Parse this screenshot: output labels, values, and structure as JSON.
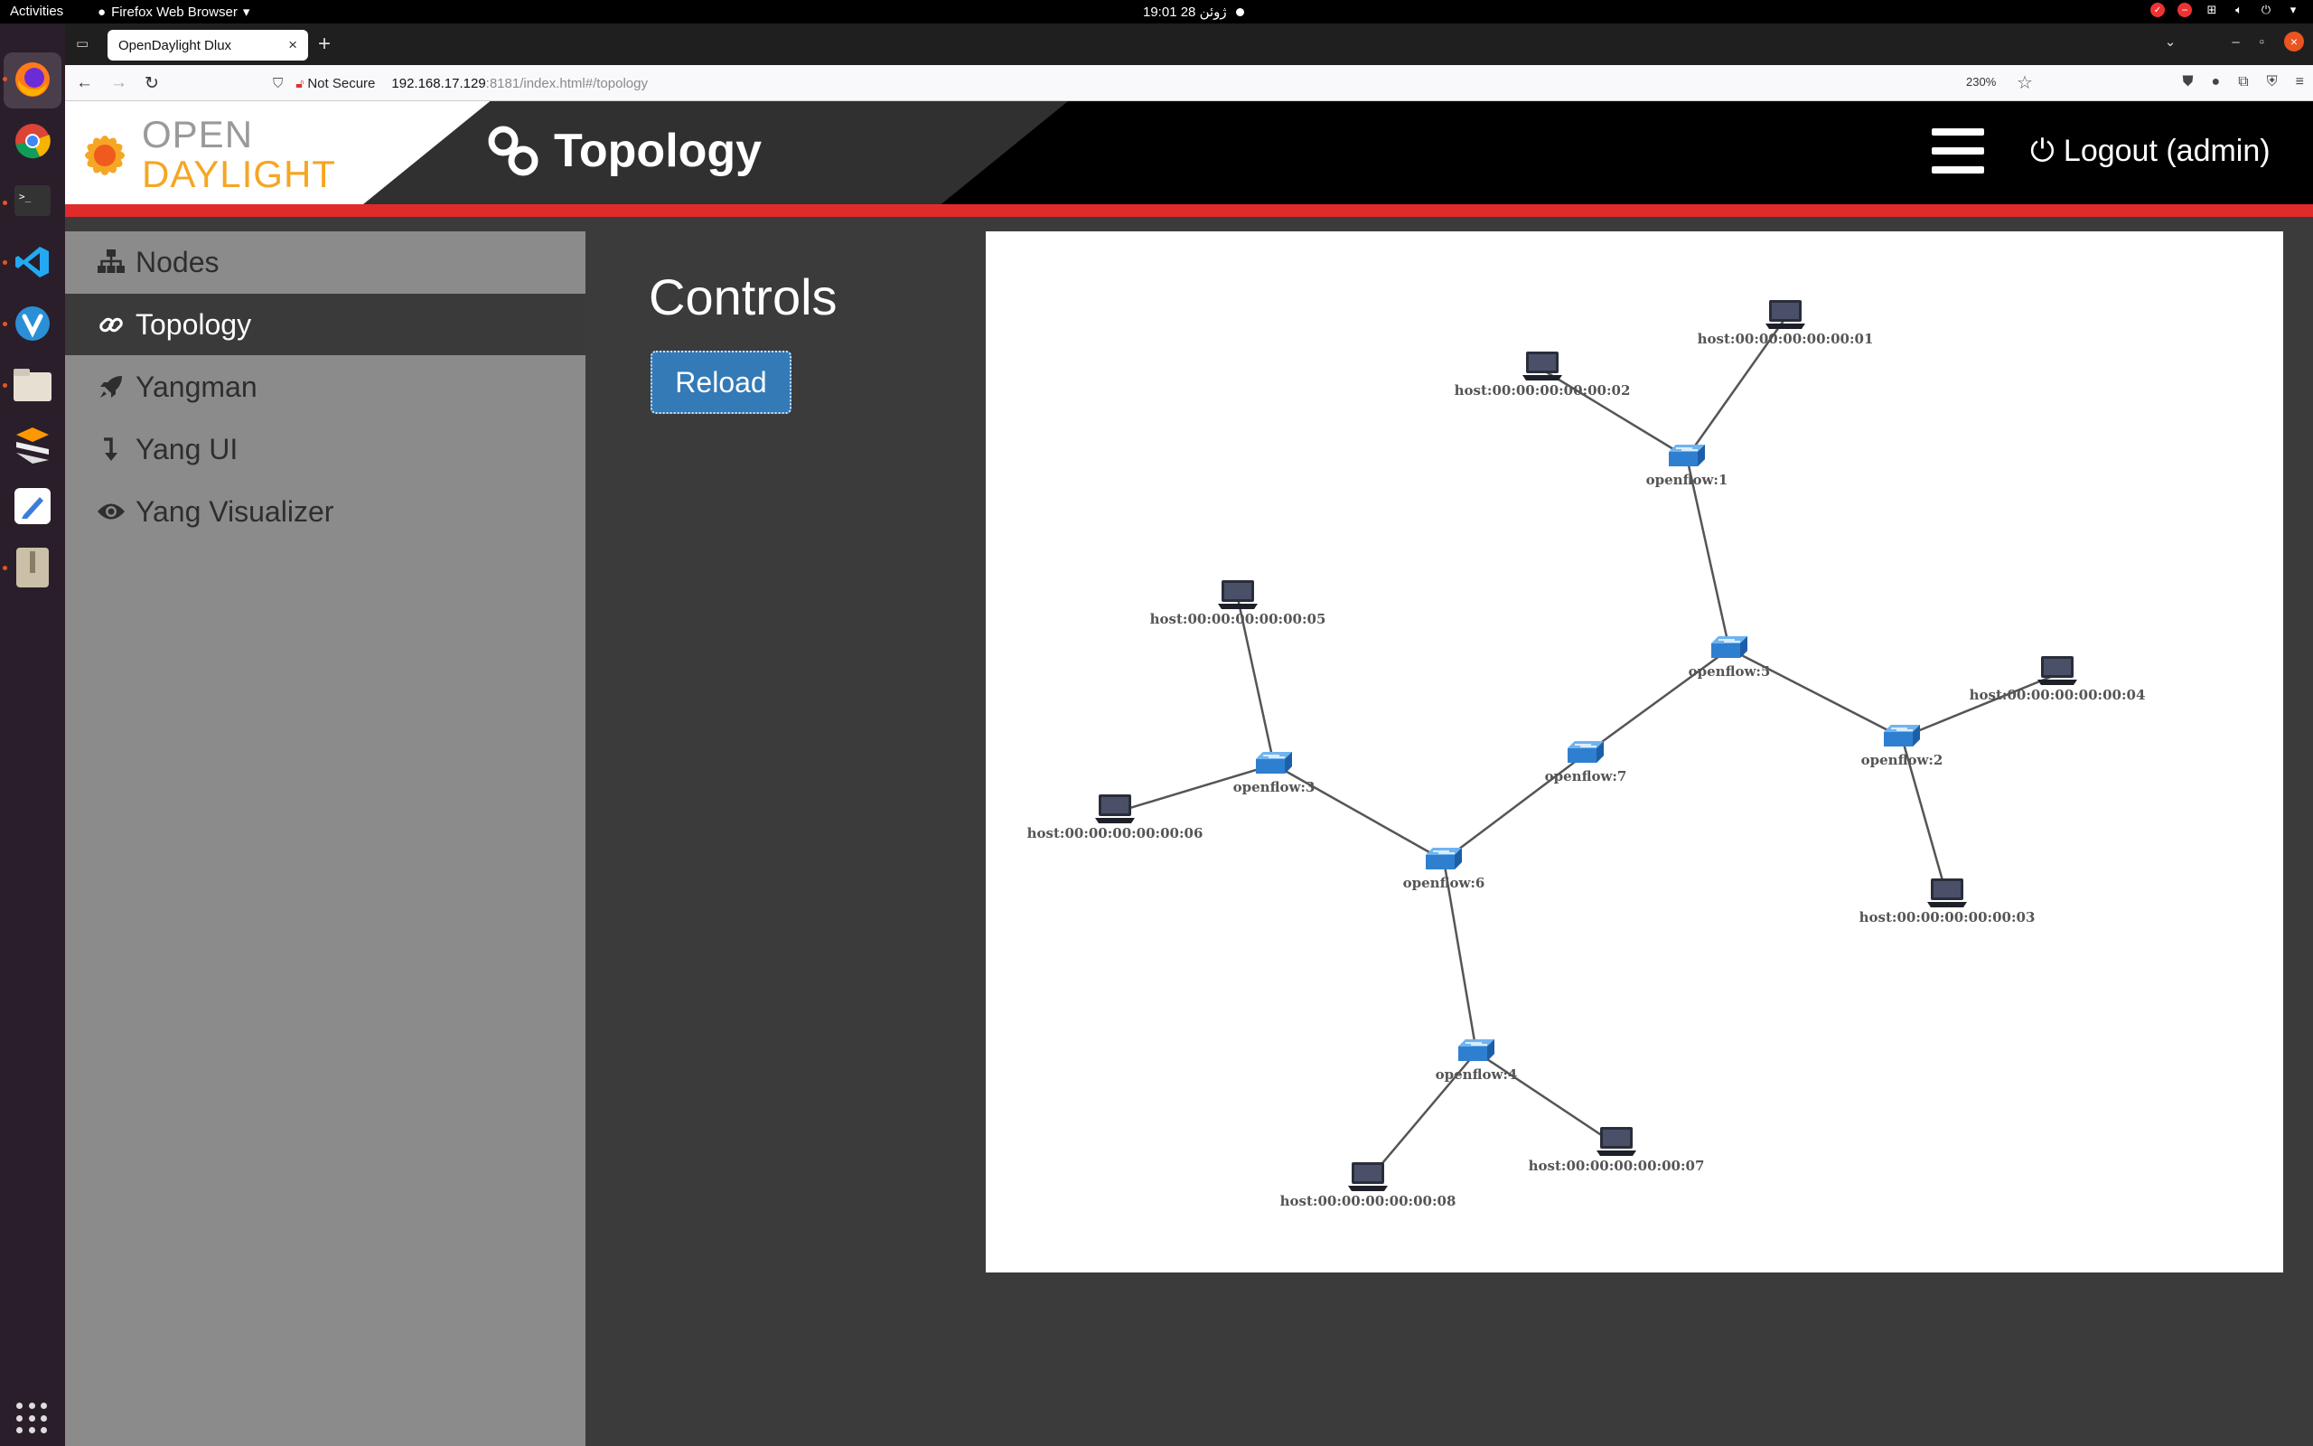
{
  "system": {
    "activities": "Activities",
    "app_menu": "Firefox Web Browser",
    "clock": "19:01  28 ژوئن"
  },
  "browser": {
    "tab_title": "OpenDaylight Dlux",
    "not_secure": "Not Secure",
    "url_host": "192.168.17.129",
    "url_path": ":8181/index.html#/topology",
    "zoom": "230%"
  },
  "header": {
    "logo_line1": "OPEN",
    "logo_line2": "DAYLIGHT",
    "page_title": "Topology",
    "logout_label": "Logout (admin)"
  },
  "sidebar": {
    "items": [
      {
        "label": "Nodes",
        "icon": "sitemap-icon"
      },
      {
        "label": "Topology",
        "icon": "link-icon"
      },
      {
        "label": "Yangman",
        "icon": "rocket-icon"
      },
      {
        "label": "Yang UI",
        "icon": "level-down-icon"
      },
      {
        "label": "Yang Visualizer",
        "icon": "eye-icon"
      }
    ],
    "active": "Topology"
  },
  "controls": {
    "heading": "Controls",
    "reload_label": "Reload"
  },
  "topology": {
    "nodes": [
      {
        "id": "openflow:1",
        "type": "switch"
      },
      {
        "id": "openflow:2",
        "type": "switch"
      },
      {
        "id": "openflow:3",
        "type": "switch"
      },
      {
        "id": "openflow:4",
        "type": "switch"
      },
      {
        "id": "openflow:5",
        "type": "switch"
      },
      {
        "id": "openflow:6",
        "type": "switch"
      },
      {
        "id": "openflow:7",
        "type": "switch"
      },
      {
        "id": "host:00:00:00:00:00:01",
        "type": "host"
      },
      {
        "id": "host:00:00:00:00:00:02",
        "type": "host"
      },
      {
        "id": "host:00:00:00:00:00:03",
        "type": "host"
      },
      {
        "id": "host:00:00:00:00:00:04",
        "type": "host"
      },
      {
        "id": "host:00:00:00:00:00:05",
        "type": "host"
      },
      {
        "id": "host:00:00:00:00:00:06",
        "type": "host"
      },
      {
        "id": "host:00:00:00:00:00:07",
        "type": "host"
      },
      {
        "id": "host:00:00:00:00:00:08",
        "type": "host"
      }
    ],
    "links": [
      [
        "openflow:1",
        "host:00:00:00:00:00:01"
      ],
      [
        "openflow:1",
        "host:00:00:00:00:00:02"
      ],
      [
        "openflow:1",
        "openflow:5"
      ],
      [
        "openflow:5",
        "openflow:2"
      ],
      [
        "openflow:5",
        "openflow:7"
      ],
      [
        "openflow:2",
        "host:00:00:00:00:00:04"
      ],
      [
        "openflow:2",
        "host:00:00:00:00:00:03"
      ],
      [
        "openflow:7",
        "openflow:6"
      ],
      [
        "openflow:6",
        "openflow:3"
      ],
      [
        "openflow:6",
        "openflow:4"
      ],
      [
        "openflow:3",
        "host:00:00:00:00:00:05"
      ],
      [
        "openflow:3",
        "host:00:00:00:00:00:06"
      ],
      [
        "openflow:4",
        "host:00:00:00:00:00:07"
      ],
      [
        "openflow:4",
        "host:00:00:00:00:00:08"
      ]
    ]
  }
}
